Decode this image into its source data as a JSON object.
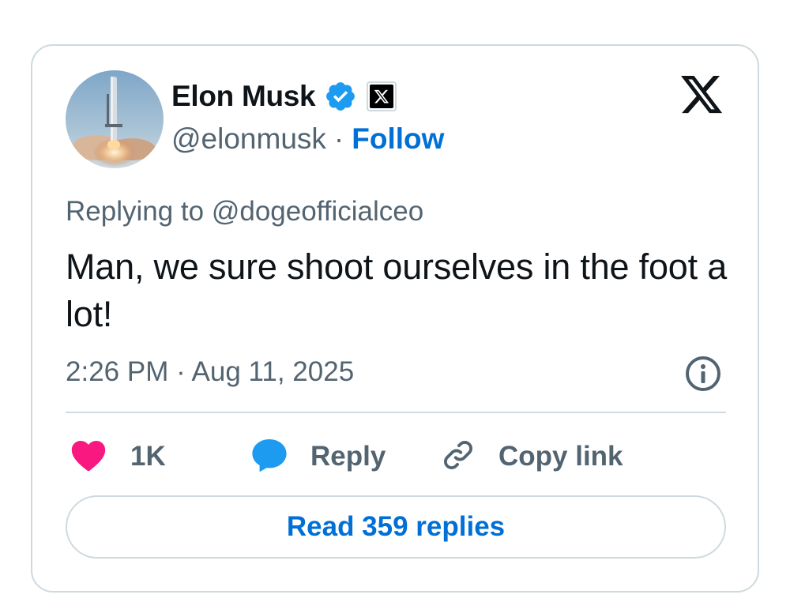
{
  "author": {
    "name": "Elon Musk",
    "handle": "@elonmusk",
    "separator": "·",
    "follow_label": "Follow"
  },
  "reply_context": "Replying to @dogeofficialceo",
  "tweet": {
    "text": "Man, we sure shoot ourselves in the foot a lot!",
    "timestamp": "2:26 PM · Aug 11, 2025"
  },
  "actions": {
    "like_count": "1K",
    "reply_label": "Reply",
    "copy_link_label": "Copy link"
  },
  "read_replies_label": "Read 359 replies",
  "icons": {
    "verified": "verified-badge-icon",
    "affiliation": "x-affiliation-icon",
    "logo": "x-logo-icon",
    "info": "info-icon",
    "like": "heart-icon",
    "reply": "speech-bubble-icon",
    "copy": "link-icon"
  },
  "colors": {
    "accent_blue": "#006fd6",
    "verified_blue": "#1d9bf0",
    "like_pink": "#f91880",
    "muted": "#536471",
    "text": "#0f1419",
    "border": "#cfd9de"
  }
}
